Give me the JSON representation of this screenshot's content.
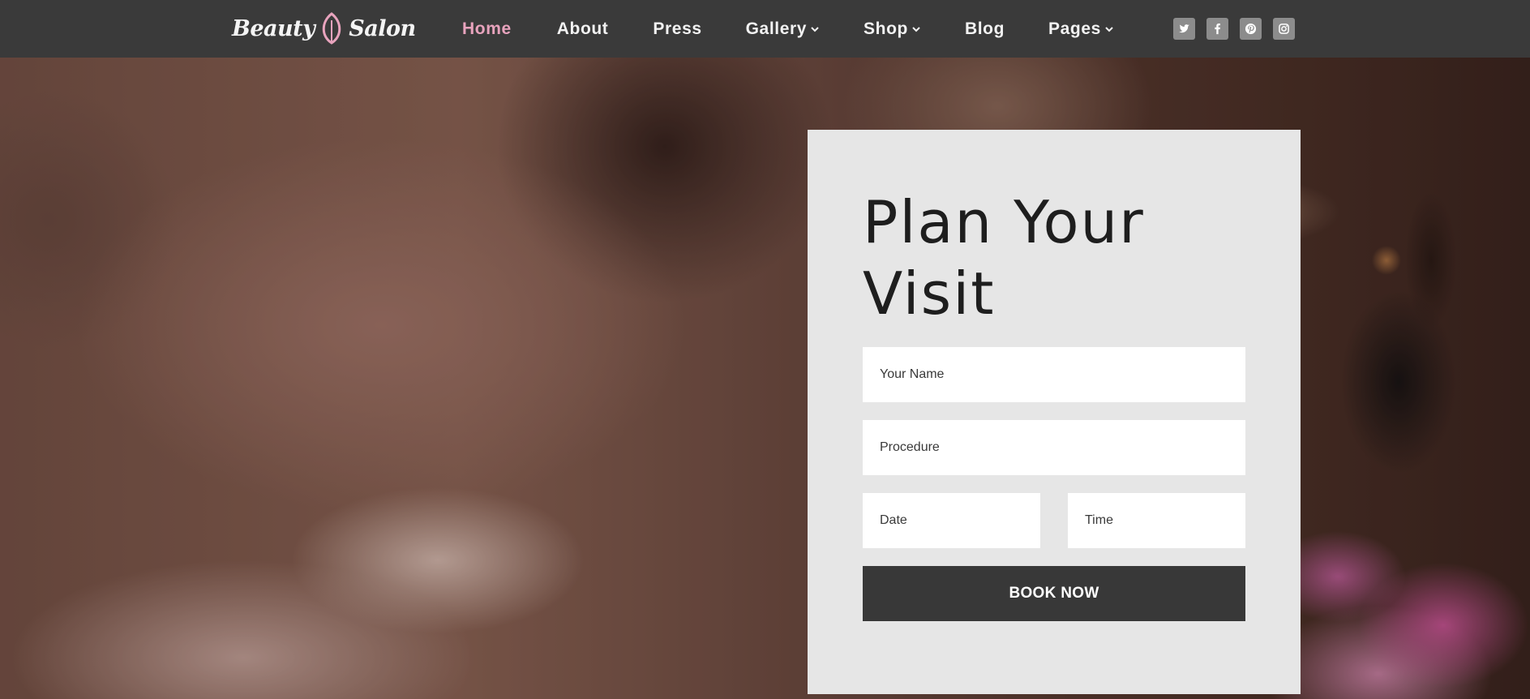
{
  "brand": {
    "name_left": "Beauty",
    "name_right": "Salon"
  },
  "nav": {
    "items": [
      {
        "label": "Home",
        "active": true,
        "dropdown": false
      },
      {
        "label": "About",
        "active": false,
        "dropdown": false
      },
      {
        "label": "Press",
        "active": false,
        "dropdown": false
      },
      {
        "label": "Gallery",
        "active": false,
        "dropdown": true
      },
      {
        "label": "Shop",
        "active": false,
        "dropdown": true
      },
      {
        "label": "Blog",
        "active": false,
        "dropdown": false
      },
      {
        "label": "Pages",
        "active": false,
        "dropdown": true
      }
    ]
  },
  "social": [
    "twitter-icon",
    "facebook-icon",
    "pinterest-icon",
    "instagram-icon"
  ],
  "booking": {
    "title": "Plan Your Visit",
    "name_placeholder": "Your Name",
    "procedure_placeholder": "Procedure",
    "date_placeholder": "Date",
    "time_placeholder": "Time",
    "submit_label": "BOOK NOW"
  },
  "colors": {
    "header_bg": "#3a3a3a",
    "nav_active": "#e8a3bd",
    "card_bg": "#e6e6e6",
    "button_bg": "#383838",
    "social_bg": "#8c8c8c"
  }
}
